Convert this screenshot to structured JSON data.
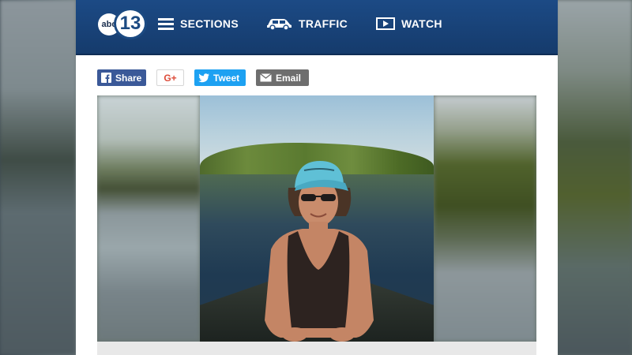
{
  "header": {
    "logo": {
      "abc": "abc",
      "number": "13"
    },
    "nav": [
      {
        "label": "SECTIONS",
        "icon": "hamburger-icon"
      },
      {
        "label": "TRAFFIC",
        "icon": "car-icon"
      },
      {
        "label": "WATCH",
        "icon": "play-icon"
      }
    ]
  },
  "share": {
    "facebook": {
      "label": "Share",
      "icon": "facebook-icon"
    },
    "google": {
      "label": "G+",
      "icon": "google-plus-icon"
    },
    "twitter": {
      "label": "Tweet",
      "icon": "twitter-bird-icon"
    },
    "email": {
      "label": "Email",
      "icon": "envelope-icon"
    }
  },
  "colors": {
    "header_bg": "#1c4a85",
    "facebook": "#3b5998",
    "twitter": "#1da1f2",
    "google_plus": "#dd4b39",
    "email": "#6e6e6e"
  },
  "media": {
    "type": "photo",
    "description_visible": false
  }
}
